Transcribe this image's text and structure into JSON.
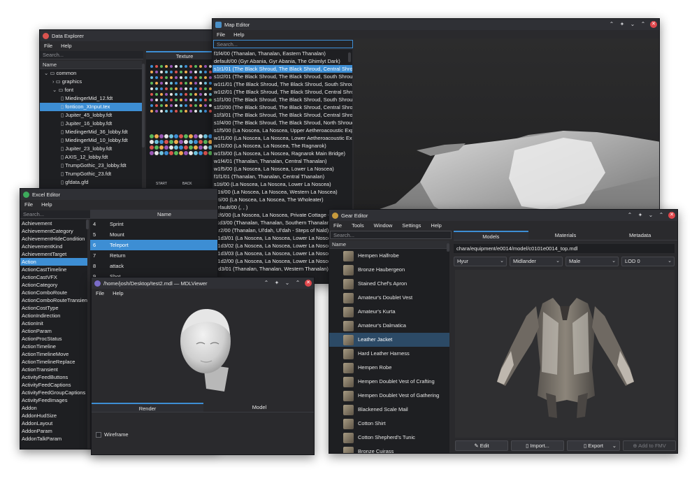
{
  "data_explorer": {
    "title": "Data Explorer",
    "menu": [
      "File",
      "Help"
    ],
    "search_placeholder": "Search...",
    "column": "Name",
    "tree": [
      {
        "label": "common",
        "level": 0,
        "type": "folder",
        "open": true
      },
      {
        "label": "graphics",
        "level": 1,
        "type": "folder",
        "open": false
      },
      {
        "label": "font",
        "level": 1,
        "type": "folder",
        "open": true
      },
      {
        "label": "MiedingerMid_12.fdt",
        "level": 2,
        "type": "file"
      },
      {
        "label": "fonticon_XInput.tex",
        "level": 2,
        "type": "image",
        "selected": true
      },
      {
        "label": "Jupiter_45_lobby.fdt",
        "level": 2,
        "type": "file"
      },
      {
        "label": "Jupiter_16_lobby.fdt",
        "level": 2,
        "type": "file"
      },
      {
        "label": "MiedingerMid_36_lobby.fdt",
        "level": 2,
        "type": "file"
      },
      {
        "label": "MiedingerMid_10_lobby.fdt",
        "level": 2,
        "type": "file"
      },
      {
        "label": "Jupiter_23_lobby.fdt",
        "level": 2,
        "type": "file"
      },
      {
        "label": "AXIS_12_lobby.fdt",
        "level": 2,
        "type": "file"
      },
      {
        "label": "TrumpGothic_23_lobby.fdt",
        "level": 2,
        "type": "file"
      },
      {
        "label": "TrumpGothic_23.fdt",
        "level": 2,
        "type": "file"
      },
      {
        "label": "gfdata.gfd",
        "level": 2,
        "type": "file"
      }
    ],
    "texture_tab": "Texture",
    "glyph_labels": [
      "START",
      "BACK"
    ]
  },
  "map_editor": {
    "title": "Map Editor",
    "menu": [
      "File",
      "Help"
    ],
    "search_placeholder": "Search...",
    "items": [
      "f1f4/00 (Thanalan, Thanalan, Eastern Thanalan)",
      "default/00 (Gyr Abania, Gyr Abania, The Ghimlyt Dark)",
      "s1t1/01 (The Black Shroud, The Black Shroud, Central Shroud)",
      "s1t2/01 (The Black Shroud, The Black Shroud, South Shroud)",
      "w1t1/01 (The Black Shroud, The Black Shroud, South Shroud)",
      "w1t2/01 (The Black Shroud, The Black Shroud, Central Shroud)",
      "s1f1/00 (The Black Shroud, The Black Shroud, South Shroud)",
      "s1f2/00 (The Black Shroud, The Black Shroud, Central Shroud)",
      "s1f3/01 (The Black Shroud, The Black Shroud, Central Shroud)",
      "s1f4/00 (The Black Shroud, The Black Shroud, North Shroud)",
      "s1f5/00 (La Noscea, La Noscea, Upper Aetheroacoustic Explo",
      "w1f1/00 (La Noscea, La Noscea, Lower Aetheroacoustic Explo",
      "w1f2/00 (La Noscea, La Noscea, The Ragnarok)",
      "w1f3/00 (La Noscea, La Noscea, Ragnarok Main Bridge)",
      "w1f4/01 (Thanalan, Thanalan, Central Thanalan)",
      "w1f5/00 (La Noscea, La Noscea, Lower La Noscea)",
      "f1f1/01 (Thanalan, Thanalan, Central Thanalan)",
      "s1ti/00 (La Noscea, La Noscea, Lower La Noscea)",
      "w1ti/00 (La Noscea, La Noscea, Western La Noscea)",
      "f1ti/00 (La Noscea, La Noscea, The Wholeater)",
      "default/00 (, , )",
      "s1f6/00 (La Noscea, La Noscea, Private Cottage - Mist",
      "s1d3/00 (Thanalan, Thanalan, Southern Thanalan)",
      "r1r2/00 (Thanalan, Ul'dah, Ul'dah - Steps of Nald)",
      "w1d3/01 (La Noscea, La Noscea, Lower La Noscea)",
      "w1d3/02 (La Noscea, La Noscea, Lower La Noscea)",
      "w1d3/03 (La Noscea, La Noscea, Lower La Noscea)",
      "w1d2/00 (La Noscea, La Noscea, Lower La Noscea)",
      "f1d3/01 (Thanalan, Thanalan, Western Thanalan)"
    ],
    "selected_index": 2
  },
  "excel_editor": {
    "title": "Excel Editor",
    "menu": [
      "File",
      "Help"
    ],
    "search_placeholder": "Search...",
    "sheets": [
      "Achievement",
      "AchievementCategory",
      "AchievementHideCondition",
      "AchievementKind",
      "AchievementTarget",
      "Action",
      "ActionCastTimeline",
      "ActionCastVFX",
      "ActionCategory",
      "ActionComboRoute",
      "ActionComboRouteTransient",
      "ActionCostType",
      "ActionIndirection",
      "ActionInit",
      "ActionParam",
      "ActionProcStatus",
      "ActionTimeline",
      "ActionTimelineMove",
      "ActionTimelineReplace",
      "ActionTransient",
      "ActivityFeedButtons",
      "ActivityFeedCaptions",
      "ActivityFeedGroupCaptions",
      "ActivityFeedImages",
      "Addon",
      "AddonHudSize",
      "AddonLayout",
      "AddonParam",
      "AddonTalkParam"
    ],
    "selected_sheet": 5,
    "table_header": "Name",
    "table_rows": [
      {
        "id": "4",
        "name": "Sprint"
      },
      {
        "id": "5",
        "name": "Mount"
      },
      {
        "id": "6",
        "name": "Teleport",
        "selected": true
      },
      {
        "id": "7",
        "name": "Return"
      },
      {
        "id": "8",
        "name": "attack"
      },
      {
        "id": "9",
        "name": "Shot"
      }
    ]
  },
  "mdl_viewer": {
    "title": "/home/josh/Desktop/test2.mdl — MDLViewer",
    "menu": [
      "File",
      "Help"
    ],
    "tabs": [
      "Render",
      "Model"
    ],
    "wireframe_label": "Wireframe"
  },
  "gear_editor": {
    "title": "Gear Editor",
    "menu": [
      "File",
      "Tools",
      "Window",
      "Settings",
      "Help"
    ],
    "search_placeholder": "Search...",
    "column": "Name",
    "items": [
      "Hempen Halfrobe",
      "Bronze Haubergeon",
      "Stained Chef's Apron",
      "Amateur's Doublet Vest",
      "Amateur's Kurta",
      "Amateur's Dalmatica",
      "Leather Jacket",
      "Hard Leather Harness",
      "Hempen Robe",
      "Hempen Doublet Vest of Crafting",
      "Hempen Doublet Vest of Gathering",
      "Blackened Scale Mail",
      "Cotton Shirt",
      "Cotton Shepherd's Tunic",
      "Bronze Cuirass"
    ],
    "selected_index": 6,
    "tabs": [
      "Models",
      "Materials",
      "Metadata"
    ],
    "path": "chara/equipment/e0014/model/c0101e0014_top.mdl",
    "race": "Hyur",
    "subrace": "Midlander",
    "gender": "Male",
    "lod": "LOD 0",
    "buttons": {
      "edit": "Edit",
      "import": "Import...",
      "export": "Export",
      "add_to_fmv": "Add to FMV"
    }
  }
}
